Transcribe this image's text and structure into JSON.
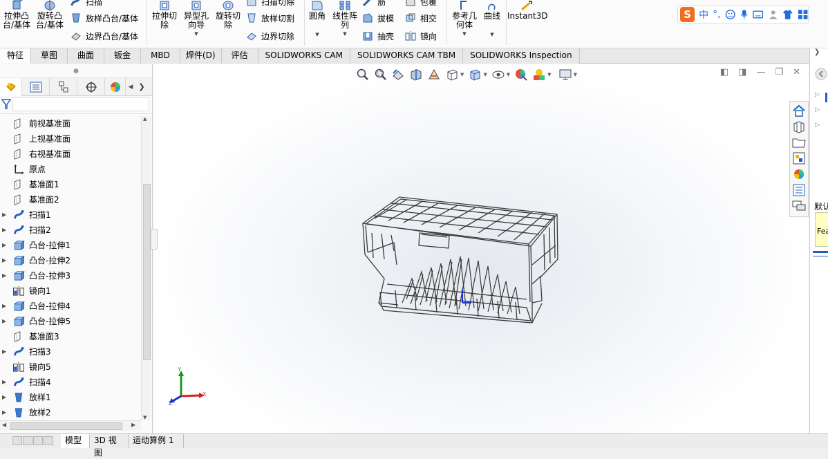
{
  "ribbon": {
    "extrude_boss": "拉伸凸\n台/基体",
    "revolve_boss": "旋转凸\n台/基体",
    "sweep": "扫描",
    "loft_boss": "放样凸台/基体",
    "boundary_boss": "边界凸台/基体",
    "extrude_cut": "拉伸切\n除",
    "hole_wizard": "异型孔\n向导",
    "revolve_cut": "旋转切\n除",
    "swept_cut": "扫描切除",
    "lofted_cut": "放样切割",
    "boundary_cut": "边界切除",
    "fillet": "圆角",
    "linear_pattern": "线性阵\n列",
    "rib": "筋",
    "draft": "拔模",
    "shell": "抽壳",
    "wrap": "包覆",
    "intersect": "相交",
    "mirror": "镜向",
    "ref_geometry": "参考几\n何体",
    "curves": "曲线",
    "instant3d": "Instant3D"
  },
  "ime": {
    "logo": "S",
    "mode": "中",
    "punct": "°,"
  },
  "tabs": [
    {
      "label": "特征",
      "active": true
    },
    {
      "label": "草图"
    },
    {
      "label": "曲面"
    },
    {
      "label": "钣金"
    },
    {
      "label": "MBD"
    },
    {
      "label": "焊件(D)"
    },
    {
      "label": "评估"
    },
    {
      "label": "SOLIDWORKS CAM"
    },
    {
      "label": "SOLIDWORKS CAM TBM"
    },
    {
      "label": "SOLIDWORKS Inspection"
    }
  ],
  "tree": [
    {
      "label": "前视基准面",
      "icon": "plane-icon",
      "expandable": false
    },
    {
      "label": "上视基准面",
      "icon": "plane-icon",
      "expandable": false
    },
    {
      "label": "右视基准面",
      "icon": "plane-icon",
      "expandable": false
    },
    {
      "label": "原点",
      "icon": "origin-icon",
      "expandable": false
    },
    {
      "label": "基准面1",
      "icon": "plane-icon",
      "expandable": false
    },
    {
      "label": "基准面2",
      "icon": "plane-icon",
      "expandable": false
    },
    {
      "label": "扫描1",
      "icon": "sweep-icon",
      "expandable": true
    },
    {
      "label": "扫描2",
      "icon": "sweep-icon",
      "expandable": true
    },
    {
      "label": "凸台-拉伸1",
      "icon": "extrude-icon",
      "expandable": true
    },
    {
      "label": "凸台-拉伸2",
      "icon": "extrude-icon",
      "expandable": true
    },
    {
      "label": "凸台-拉伸3",
      "icon": "extrude-icon",
      "expandable": true
    },
    {
      "label": "镜向1",
      "icon": "mirror-icon",
      "expandable": false
    },
    {
      "label": "凸台-拉伸4",
      "icon": "extrude-icon",
      "expandable": true
    },
    {
      "label": "凸台-拉伸5",
      "icon": "extrude-icon",
      "expandable": true
    },
    {
      "label": "基准面3",
      "icon": "plane-icon",
      "expandable": false
    },
    {
      "label": "扫描3",
      "icon": "sweep-icon",
      "expandable": true
    },
    {
      "label": "镜向5",
      "icon": "mirror-icon",
      "expandable": false
    },
    {
      "label": "扫描4",
      "icon": "sweep-icon",
      "expandable": true
    },
    {
      "label": "放样1",
      "icon": "loft-icon",
      "expandable": true
    },
    {
      "label": "放样2",
      "icon": "loft-icon",
      "expandable": true
    }
  ],
  "triad": {
    "x": "X",
    "y": "Y",
    "z": "Z"
  },
  "right_panel": {
    "tip_line1": "默认",
    "tip_line2": "Fea"
  },
  "bottom_tabs": [
    {
      "label": "模型",
      "active": true
    },
    {
      "label": "3D 视图"
    },
    {
      "label": "运动算例 1"
    }
  ],
  "colors": {
    "accent_blue": "#1f5fbf",
    "triad_red": "#d62020",
    "triad_green": "#1a9a1a",
    "triad_blue": "#1c2fcf"
  }
}
